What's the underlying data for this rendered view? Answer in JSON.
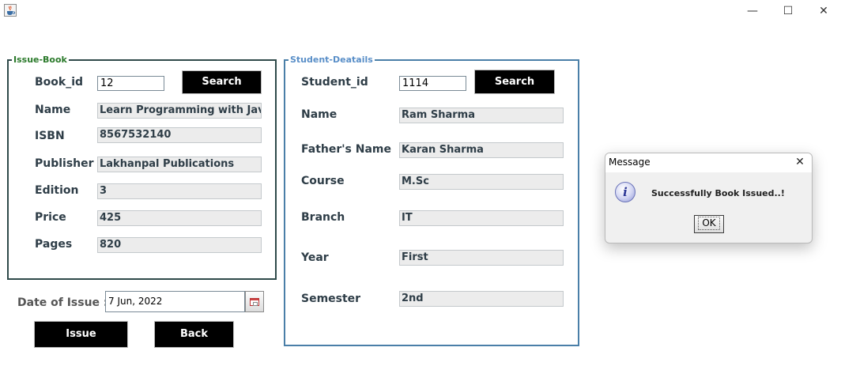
{
  "window": {
    "icon": "java-cup-icon",
    "minimize_glyph": "—",
    "maximize_glyph": "☐",
    "close_glyph": "✕"
  },
  "issue_book": {
    "legend": "Issue-Book",
    "book_id_label": "Book_id",
    "book_id_value": "12",
    "search_label": "Search",
    "fields": [
      {
        "label": "Name",
        "value": "Learn Programming with Java"
      },
      {
        "label": "ISBN",
        "value": "8567532140"
      },
      {
        "label": "Publisher",
        "value": "Lakhanpal Publications"
      },
      {
        "label": "Edition",
        "value": "3"
      },
      {
        "label": "Price",
        "value": "425"
      },
      {
        "label": "Pages",
        "value": "820"
      }
    ]
  },
  "student_details": {
    "legend": "Student-Deatails",
    "student_id_label": "Student_id",
    "student_id_value": "1114",
    "search_label": "Search",
    "fields": [
      {
        "label": "Name",
        "value": "Ram Sharma"
      },
      {
        "label": "Father's Name",
        "value": "Karan Sharma"
      },
      {
        "label": "Course",
        "value": "M.Sc"
      },
      {
        "label": "Branch",
        "value": "IT"
      },
      {
        "label": "Year",
        "value": "First"
      },
      {
        "label": "Semester",
        "value": "2nd"
      }
    ]
  },
  "issue_date": {
    "label": "Date of Issue :",
    "value": "7 Jun, 2022",
    "picker_icon": "calendar-icon"
  },
  "actions": {
    "issue_label": "Issue",
    "back_label": "Back"
  },
  "dialog": {
    "title": "Message",
    "close_glyph": "✕",
    "icon": "info-icon",
    "icon_glyph": "i",
    "message": "Successfully Book Issued..!",
    "ok_label": "OK"
  },
  "colors": {
    "issue_legend": "#2b7a2b",
    "student_legend": "#5a8fc8",
    "button_bg": "#000000",
    "button_text": "#ffffff"
  }
}
